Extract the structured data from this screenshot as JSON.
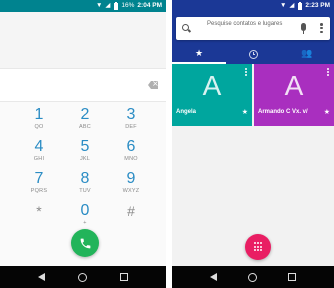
{
  "left_phone": {
    "status_bar": {
      "battery": "16%",
      "time": "2:04 PM"
    },
    "digits_value": "",
    "keypad": [
      {
        "num": "1",
        "letters": "QO"
      },
      {
        "num": "2",
        "letters": "ABC"
      },
      {
        "num": "3",
        "letters": "DEF"
      },
      {
        "num": "4",
        "letters": "GHI"
      },
      {
        "num": "5",
        "letters": "JKL"
      },
      {
        "num": "6",
        "letters": "MNO"
      },
      {
        "num": "7",
        "letters": "PQRS"
      },
      {
        "num": "8",
        "letters": "TUV"
      },
      {
        "num": "9",
        "letters": "WXYZ"
      },
      {
        "num": "*",
        "letters": ""
      },
      {
        "num": "0",
        "letters": "+"
      },
      {
        "num": "#",
        "letters": ""
      }
    ],
    "colors": {
      "accent": "#2a8cc4",
      "call": "#22b45a",
      "status": "#00838f"
    }
  },
  "right_phone": {
    "status_bar": {
      "time": "2:23 PM"
    },
    "search": {
      "placeholder": "Pesquise contatos e lugares"
    },
    "tabs": [
      {
        "icon": "star-icon",
        "active": true
      },
      {
        "icon": "clock-icon",
        "active": false
      },
      {
        "icon": "people-icon",
        "active": false
      }
    ],
    "contacts": [
      {
        "initial": "A",
        "name": "Angela",
        "color": "#00a69e"
      },
      {
        "initial": "A",
        "name": "Armando C Vx. v/",
        "color": "#a92fbf"
      }
    ],
    "colors": {
      "app_bar": "#1b3896",
      "fab": "#e91e63"
    }
  }
}
